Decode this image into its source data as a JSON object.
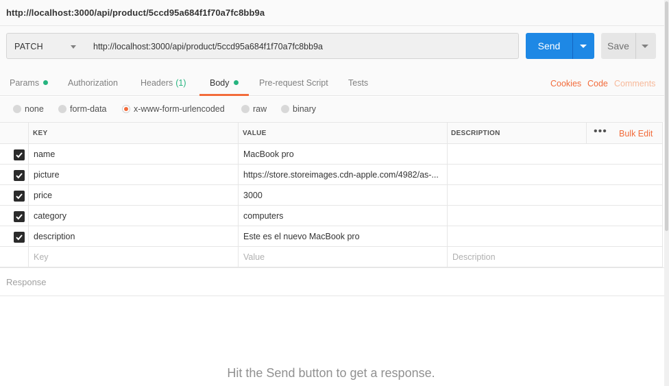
{
  "window": {
    "title": "http://localhost:3000/api/product/5ccd95a684f1f70a7fc8bb9a"
  },
  "request": {
    "method": "PATCH",
    "url": "http://localhost:3000/api/product/5ccd95a684f1f70a7fc8bb9a",
    "send_label": "Send",
    "save_label": "Save"
  },
  "tabs": [
    {
      "label": "Params",
      "indicator": "dot"
    },
    {
      "label": "Authorization"
    },
    {
      "label": "Headers",
      "count": "(1)"
    },
    {
      "label": "Body",
      "indicator": "dot",
      "active": true
    },
    {
      "label": "Pre-request Script"
    },
    {
      "label": "Tests"
    }
  ],
  "right_links": {
    "cookies": "Cookies",
    "code": "Code",
    "comments": "Comments"
  },
  "body_types": [
    {
      "label": "none"
    },
    {
      "label": "form-data"
    },
    {
      "label": "x-www-form-urlencoded",
      "selected": true
    },
    {
      "label": "raw"
    },
    {
      "label": "binary"
    }
  ],
  "kv_table": {
    "headers": {
      "key": "KEY",
      "value": "VALUE",
      "description": "DESCRIPTION"
    },
    "bulk_edit": "Bulk Edit",
    "more_icon": "more-dots-icon",
    "rows": [
      {
        "key": "name",
        "value": "MacBook pro",
        "checked": true
      },
      {
        "key": "picture",
        "value": "https://store.storeimages.cdn-apple.com/4982/as-...",
        "checked": true
      },
      {
        "key": "price",
        "value": "3000",
        "checked": true
      },
      {
        "key": "category",
        "value": "computers",
        "checked": true
      },
      {
        "key": "description",
        "value": "Este es el nuevo MacBook pro",
        "checked": true
      }
    ],
    "placeholders": {
      "key": "Key",
      "value": "Value",
      "description": "Description"
    }
  },
  "response": {
    "label": "Response",
    "hint": "Hit the Send button to get a response."
  },
  "colors": {
    "accent": "#f26b3a",
    "send": "#1e88e5",
    "indicator": "#26b47f"
  }
}
